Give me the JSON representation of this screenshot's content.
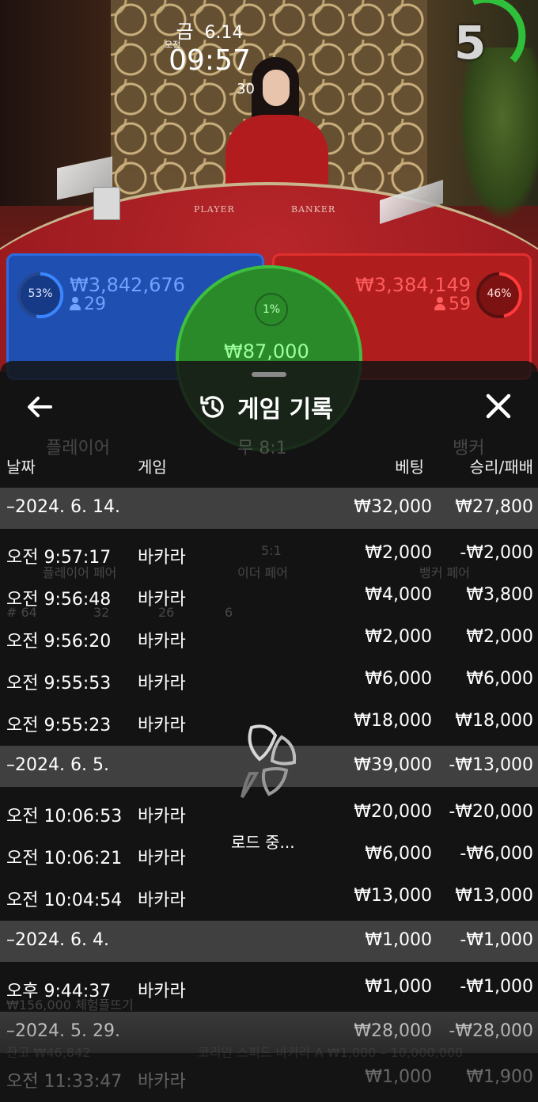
{
  "stream": {
    "day": "금",
    "date": "6.14",
    "ampm": "오전",
    "time": "09:57",
    "seconds": "30",
    "countdown": "5",
    "table_label_player": "PLAYER",
    "table_label_banker": "BANKER"
  },
  "bets": {
    "player": {
      "percent": "53%",
      "amount": "₩3,842,676",
      "count": "29"
    },
    "tie": {
      "percent": "1%",
      "amount": "₩87,000"
    },
    "banker": {
      "percent": "46%",
      "amount": "₩3,384,149",
      "count": "59"
    }
  },
  "background_ui": {
    "player_title": "플레이어",
    "tie_title": "무 8:1",
    "banker_title": "뱅커",
    "player_pair": "플레이어 페어",
    "either_pair": "이더 페어",
    "banker_pair": "뱅커 페어",
    "odds_either": "5:1",
    "stat_rounds": "# 64",
    "stat_p": "32",
    "stat_b": "26",
    "stat_t": "6",
    "bottom_text": "₩156,000 체험플뜨기",
    "balance_text": "잔고 ₩46,842",
    "table_name": "코리안 스피드 바카라 A  ₩1,000 – 10,000,000"
  },
  "sheet": {
    "title": "게임 기록",
    "columns": {
      "date": "날짜",
      "game": "게임",
      "bet": "베팅",
      "result": "승리/패배"
    },
    "loading": "로드 중...",
    "groups": [
      {
        "date": "–2024. 6. 14.",
        "bet": "₩32,000",
        "result": "₩27,800",
        "rows": [
          {
            "time": "오전 9:57:17",
            "game": "바카라",
            "bet": "₩2,000",
            "result": "-₩2,000"
          },
          {
            "time": "오전 9:56:48",
            "game": "바카라",
            "bet": "₩4,000",
            "result": "₩3,800"
          },
          {
            "time": "오전 9:56:20",
            "game": "바카라",
            "bet": "₩2,000",
            "result": "₩2,000"
          },
          {
            "time": "오전 9:55:53",
            "game": "바카라",
            "bet": "₩6,000",
            "result": "₩6,000"
          },
          {
            "time": "오전 9:55:23",
            "game": "바카라",
            "bet": "₩18,000",
            "result": "₩18,000"
          }
        ]
      },
      {
        "date": "–2024. 6. 5.",
        "bet": "₩39,000",
        "result": "-₩13,000",
        "rows": [
          {
            "time": "오전 10:06:53",
            "game": "바카라",
            "bet": "₩20,000",
            "result": "-₩20,000"
          },
          {
            "time": "오전 10:06:21",
            "game": "바카라",
            "bet": "₩6,000",
            "result": "-₩6,000"
          },
          {
            "time": "오전 10:04:54",
            "game": "바카라",
            "bet": "₩13,000",
            "result": "₩13,000"
          }
        ]
      },
      {
        "date": "–2024. 6. 4.",
        "bet": "₩1,000",
        "result": "-₩1,000",
        "rows": [
          {
            "time": "오후 9:44:37",
            "game": "바카라",
            "bet": "₩1,000",
            "result": "-₩1,000"
          }
        ]
      },
      {
        "date": "–2024. 5. 29.",
        "bet": "₩28,000",
        "result": "-₩28,000",
        "rows": [
          {
            "time": "오전 11:33:47",
            "game": "바카라",
            "bet": "₩1,000",
            "result": "₩1,900"
          }
        ]
      }
    ]
  },
  "colors": {
    "player_blue": "#1f4fb0",
    "banker_red": "#b01d1d",
    "tie_green": "#2a8a2a",
    "timer_green": "#2fbf3a",
    "sheet_bg": "#141414"
  }
}
